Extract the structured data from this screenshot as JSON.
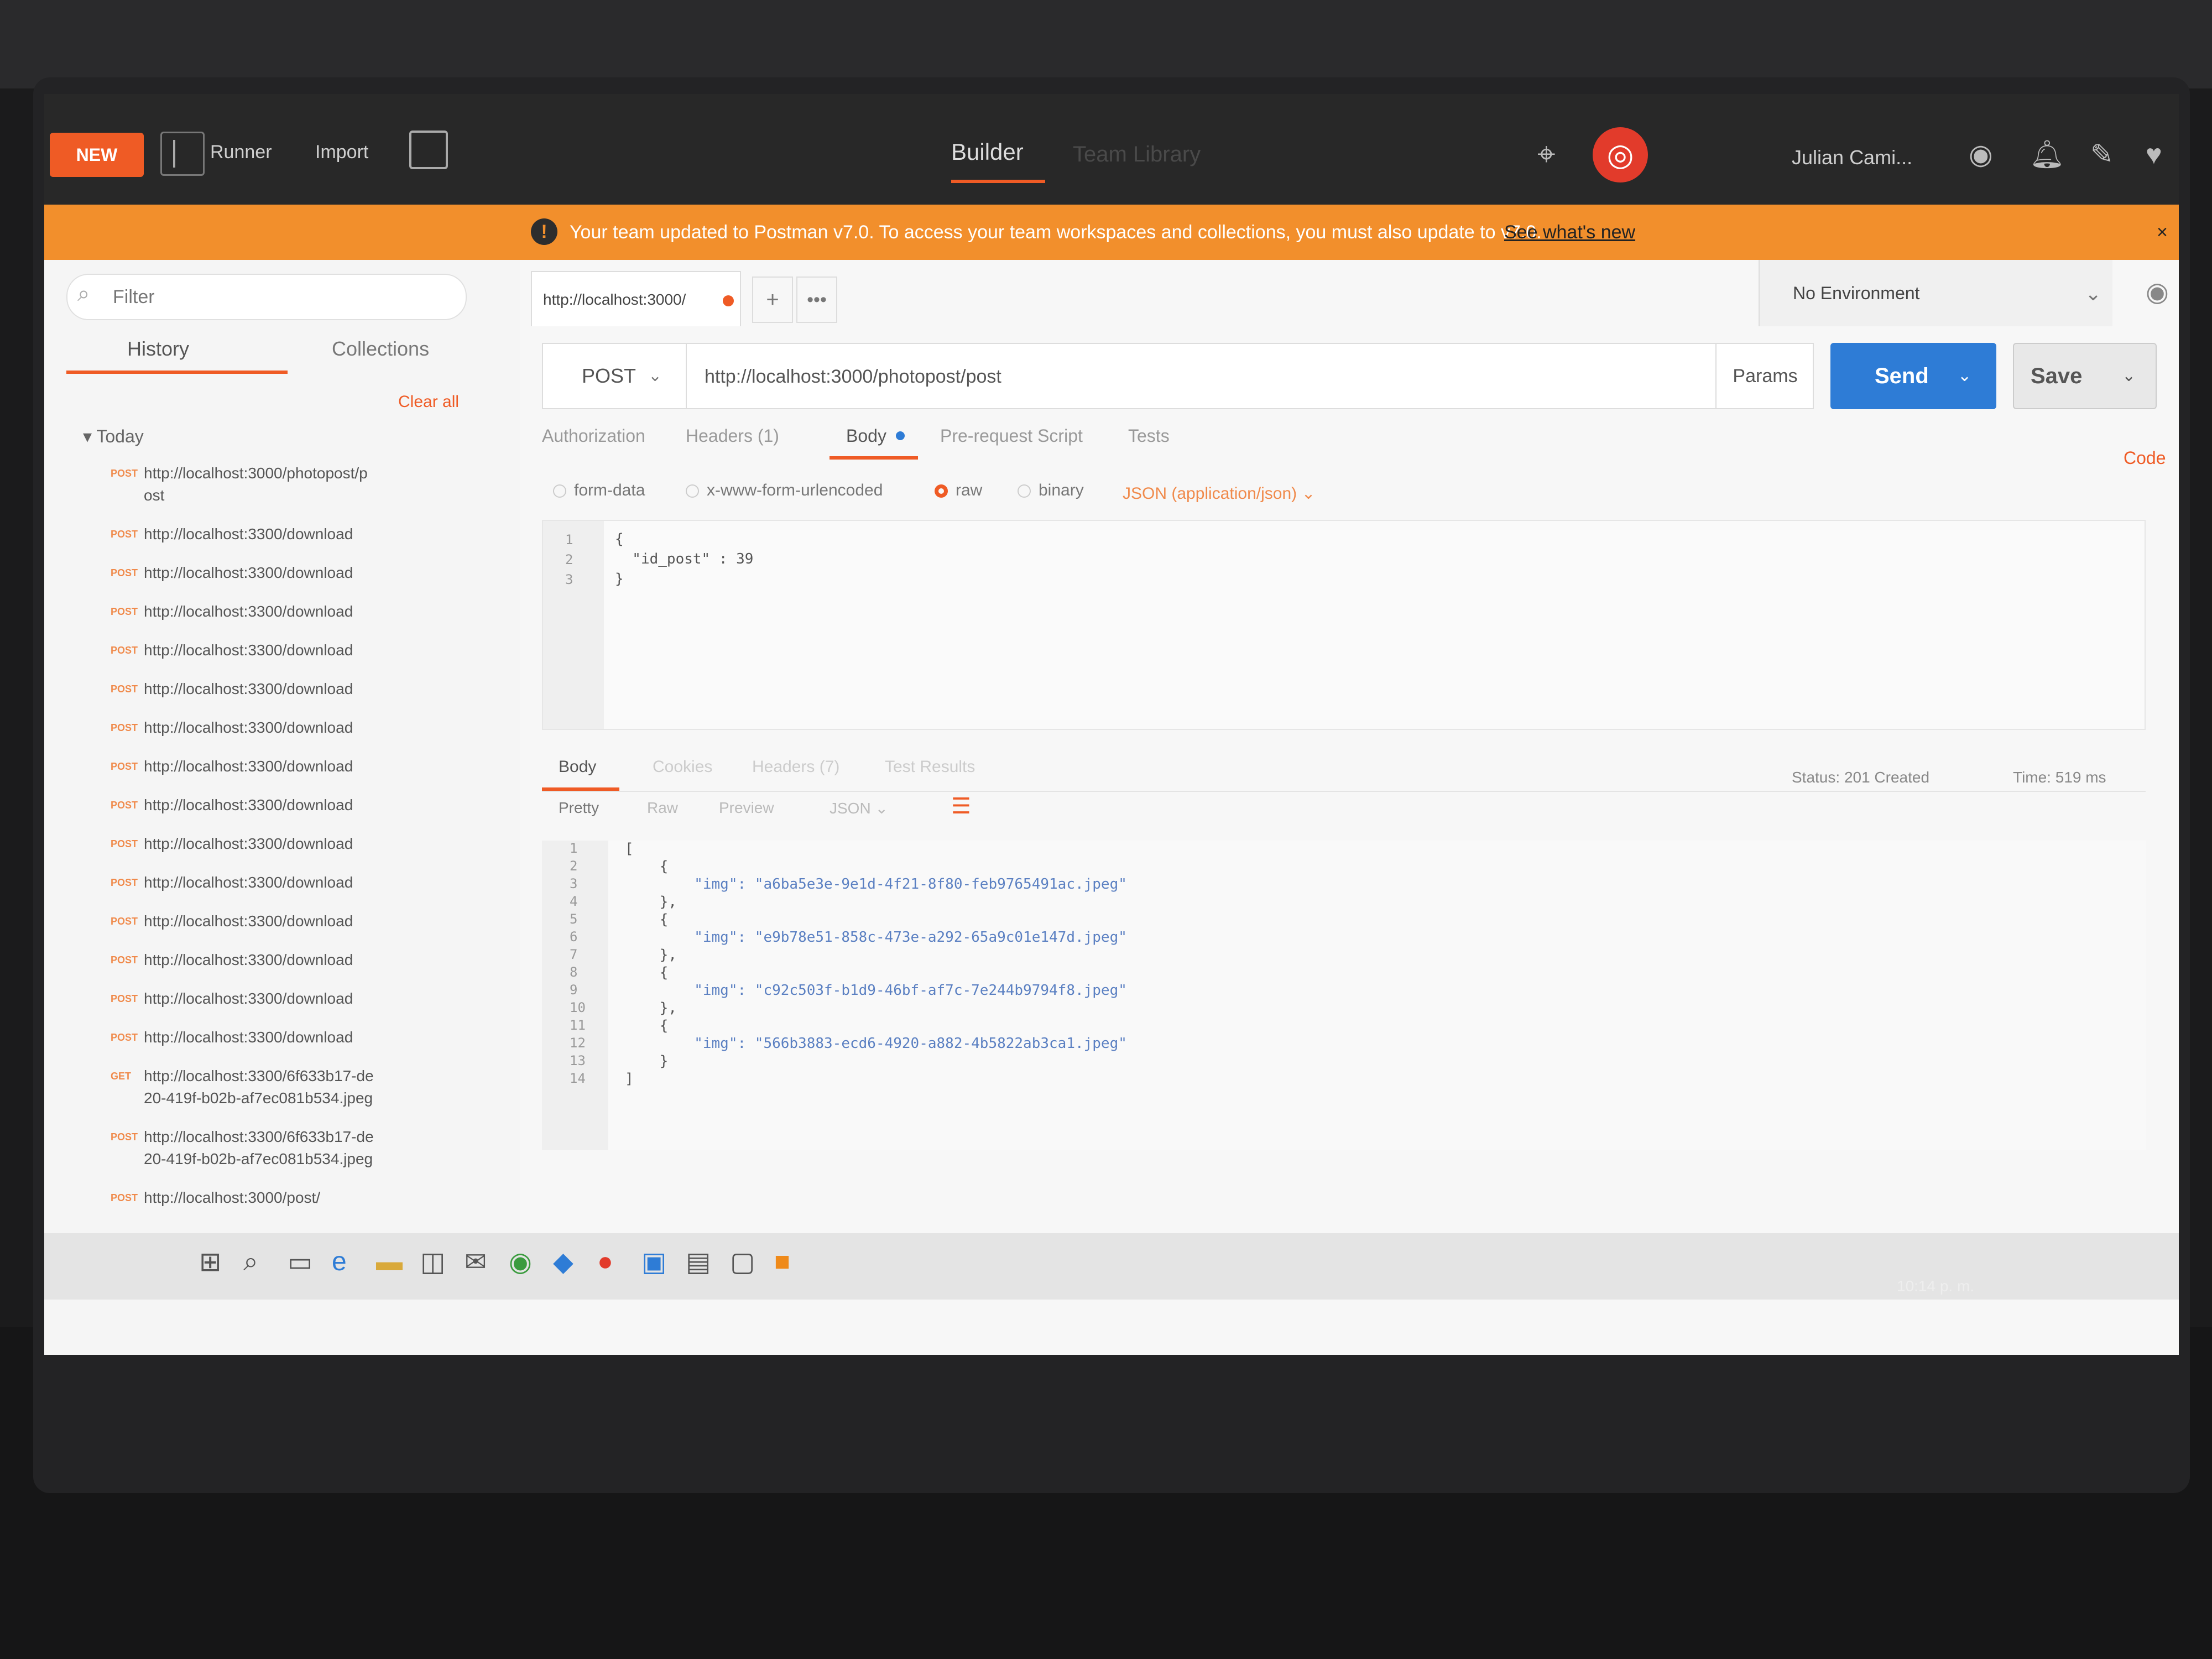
{
  "header": {
    "new_label": "NEW",
    "runner_label": "Runner",
    "import_label": "Import",
    "builder_tab": "Builder",
    "team_library_tab": "Team Library",
    "user_name": "Julian Cami...",
    "accent": "#ef5b25"
  },
  "banner": {
    "text": "Your team updated to Postman v7.0. To access your team workspaces and collections, you must also update to v7.0.",
    "link": "See what's new"
  },
  "sidebar": {
    "filter_placeholder": "Filter",
    "tabs": [
      "History",
      "Collections"
    ],
    "clear_all": "Clear all",
    "group": "Today",
    "history": [
      {
        "method": "POST",
        "url": "http://localhost:3000/photopost/p"
      },
      {
        "method": "",
        "url": "ost"
      },
      {
        "method": "POST",
        "url": "http://localhost:3300/download"
      },
      {
        "method": "POST",
        "url": "http://localhost:3300/download"
      },
      {
        "method": "POST",
        "url": "http://localhost:3300/download"
      },
      {
        "method": "POST",
        "url": "http://localhost:3300/download"
      },
      {
        "method": "POST",
        "url": "http://localhost:3300/download"
      },
      {
        "method": "POST",
        "url": "http://localhost:3300/download"
      },
      {
        "method": "POST",
        "url": "http://localhost:3300/download"
      },
      {
        "method": "POST",
        "url": "http://localhost:3300/download"
      },
      {
        "method": "POST",
        "url": "http://localhost:3300/download"
      },
      {
        "method": "POST",
        "url": "http://localhost:3300/download"
      },
      {
        "method": "POST",
        "url": "http://localhost:3300/download"
      },
      {
        "method": "POST",
        "url": "http://localhost:3300/download"
      },
      {
        "method": "POST",
        "url": "http://localhost:3300/download"
      },
      {
        "method": "POST",
        "url": "http://localhost:3300/download"
      },
      {
        "method": "GET",
        "url": "http://localhost:3300/6f633b17-de"
      },
      {
        "method": "",
        "url": "20-419f-b02b-af7ec081b534.jpeg"
      },
      {
        "method": "POST",
        "url": "http://localhost:3300/6f633b17-de"
      },
      {
        "method": "",
        "url": "20-419f-b02b-af7ec081b534.jpeg"
      },
      {
        "method": "POST",
        "url": "http://localhost:3000/post/"
      }
    ]
  },
  "request": {
    "tab_title": "http://localhost:3000/",
    "environment": "No Environment",
    "method": "POST",
    "url": "http://localhost:3000/photopost/post",
    "params_label": "Params",
    "send_label": "Send",
    "save_label": "Save",
    "tabs": {
      "authorization": "Authorization",
      "headers": "Headers (1)",
      "body": "Body",
      "prerequest": "Pre-request Script",
      "tests": "Tests"
    },
    "code_link": "Code",
    "body_modes": [
      "form-data",
      "x-www-form-urlencoded",
      "raw",
      "binary"
    ],
    "content_type": "JSON (application/json)",
    "body_lines": [
      "{",
      "  \"id_post\" : 39",
      "}"
    ]
  },
  "response": {
    "tabs": {
      "body": "Body",
      "cookies": "Cookies",
      "headers": "Headers (7)",
      "tests": "Test Results"
    },
    "status": "Status: 201 Created",
    "time": "Time: 519 ms",
    "views": {
      "pretty": "Pretty",
      "raw": "Raw",
      "preview": "Preview",
      "format": "JSON"
    },
    "lines": [
      "[",
      "    {",
      "        \"img\": \"a6ba5e3e-9e1d-4f21-8f80-feb9765491ac.jpeg\"",
      "    },",
      "    {",
      "        \"img\": \"e9b78e51-858c-473e-a292-65a9c01e147d.jpeg\"",
      "    },",
      "    {",
      "        \"img\": \"c92c503f-b1d9-46bf-af7c-7e244b9794f8.jpeg\"",
      "    },",
      "    {",
      "        \"img\": \"566b3883-ecd6-4920-a882-4b5822ab3ca1.jpeg\"",
      "    }",
      "]"
    ]
  },
  "taskbar": {
    "clock": "10:14 p. m."
  }
}
